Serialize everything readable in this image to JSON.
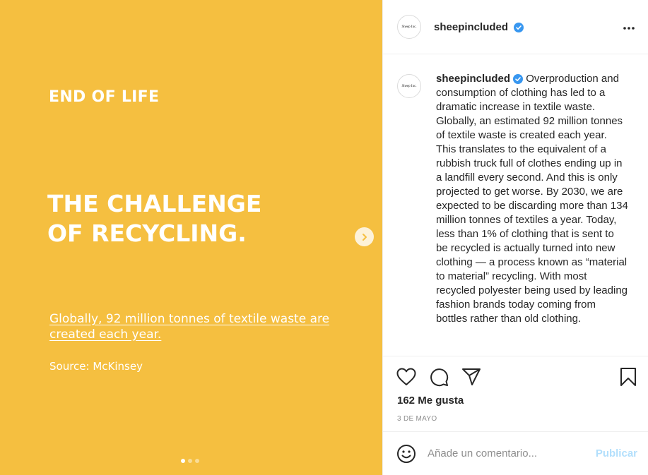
{
  "slide": {
    "eyebrow": "END OF LIFE",
    "headline_line1": "THE CHALLENGE",
    "headline_line2": "OF RECYCLING.",
    "fact": "Globally, 92 million tonnes of textile waste are created each year.",
    "source": "Source: McKinsey",
    "background_color": "#f5bf40",
    "slide_count": 3,
    "active_slide": 1
  },
  "header": {
    "avatar_text": "Sheep Inc.",
    "username": "sheepincluded",
    "verified": true,
    "more_icon": "more-horizontal-icon"
  },
  "caption": {
    "username": "sheepincluded",
    "text": "Overproduction and consumption of clothing has led to a dramatic increase in textile waste. Globally, an estimated 92 million tonnes of textile waste is created each year. This translates to the equivalent of a rubbish truck full of clothes ending up in a landfill every second. And this is only projected to get worse. By 2030, we are expected to be discarding more than 134 million tonnes of textiles a year. Today, less than 1% of clothing that is sent to be recycled is actually turned into new clothing — a process known as “material to material” recycling. With most recycled polyester being used by leading fashion brands today coming from bottles rather than old clothing."
  },
  "actions": {
    "likes": "162 Me gusta",
    "date": "3 DE MAYO"
  },
  "comment": {
    "placeholder": "Añade un comentario...",
    "publish_label": "Publicar"
  },
  "colors": {
    "verified_blue": "#3897f0",
    "publish_disabled": "#b2dffc"
  }
}
